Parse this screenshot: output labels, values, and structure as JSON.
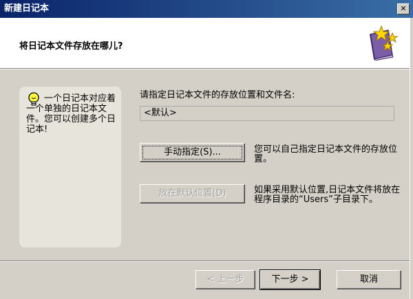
{
  "window": {
    "title": "新建日记本",
    "close_glyph": "✕"
  },
  "header": {
    "title": "将日记本文件存放在哪儿?",
    "icon": "star-book-icon"
  },
  "tip": {
    "icon": "lightbulb-icon",
    "text": "一个日记本对应着一个单独的日记本文件。您可以创建多个日记本!"
  },
  "location": {
    "label": "请指定日记本文件的存放位置和文件名:",
    "value": "<默认>"
  },
  "manual": {
    "button_label": "手动指定(S)...",
    "description": "您可以自己指定日记本文件的存放位置。"
  },
  "default_location": {
    "button_label": "放在默认位置(D)",
    "description": "如果采用默认位置,日记本文件将放在程序目录的“Users”子目录下。"
  },
  "footer": {
    "back_label": "< 上一步",
    "next_label": "下一步 >",
    "cancel_label": "取消"
  },
  "colors": {
    "title_bar_start": "#0a246a",
    "title_bar_end": "#3a6ea5",
    "dialog_bg": "#d4d0c8",
    "tip_panel_bg": "#e7e4dc",
    "disabled_text": "#a0a0a0"
  }
}
